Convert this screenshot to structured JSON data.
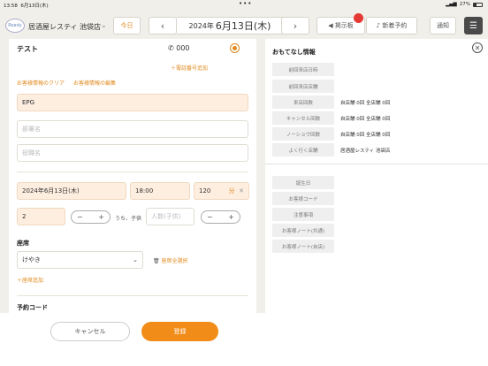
{
  "status": {
    "time": "13:58",
    "date": "6月13日(木)",
    "battery": "27%"
  },
  "header": {
    "logo": "Ready",
    "store": "居酒屋レスティ 池袋店",
    "today": "今日",
    "year": "2024年",
    "date": "6月13日(木)",
    "board": "掲示板",
    "new_reservation": "新着予約",
    "notice": "通知"
  },
  "form": {
    "name": "テスト",
    "phone": "000",
    "add_phone": "＋電話番号追加",
    "clear_link": "お客様情報のクリア",
    "edit_link": "お客様情報の編集",
    "company": "EPG",
    "department_ph": "部署名",
    "position_ph": "役職名",
    "date": "2024年6月13日(木)",
    "time": "18:00",
    "duration": "120",
    "duration_unit": "分",
    "people": "2",
    "children_label": "うち、子供",
    "children_ph": "人数(子供)",
    "seat_section": "座席",
    "seat": "けやき",
    "seat_clear": "座席全選択",
    "add_seat": "＋座席追加",
    "code_section": "予約コード"
  },
  "footer": {
    "cancel": "キャンセル",
    "register": "登録"
  },
  "hospitality": {
    "title": "おもてなし情報",
    "rows": [
      {
        "label": "前回来店日時",
        "value": ""
      },
      {
        "label": "前回来店店舗",
        "value": ""
      },
      {
        "label": "来店回数",
        "value": "自店舗 0回 全店舗 0回"
      },
      {
        "label": "キャンセル回数",
        "value": "自店舗 0回 全店舗 0回"
      },
      {
        "label": "ノーショウ回数",
        "value": "自店舗 0回 全店舗 0回"
      },
      {
        "label": "よく行く店舗",
        "value": "居酒屋レスティ 池袋店"
      }
    ],
    "rows2": [
      {
        "label": "誕生日"
      },
      {
        "label": "お客様コード"
      },
      {
        "label": "注意事項"
      },
      {
        "label": "お客様ノート(共通)"
      },
      {
        "label": "お客様ノート(自店)"
      }
    ]
  }
}
